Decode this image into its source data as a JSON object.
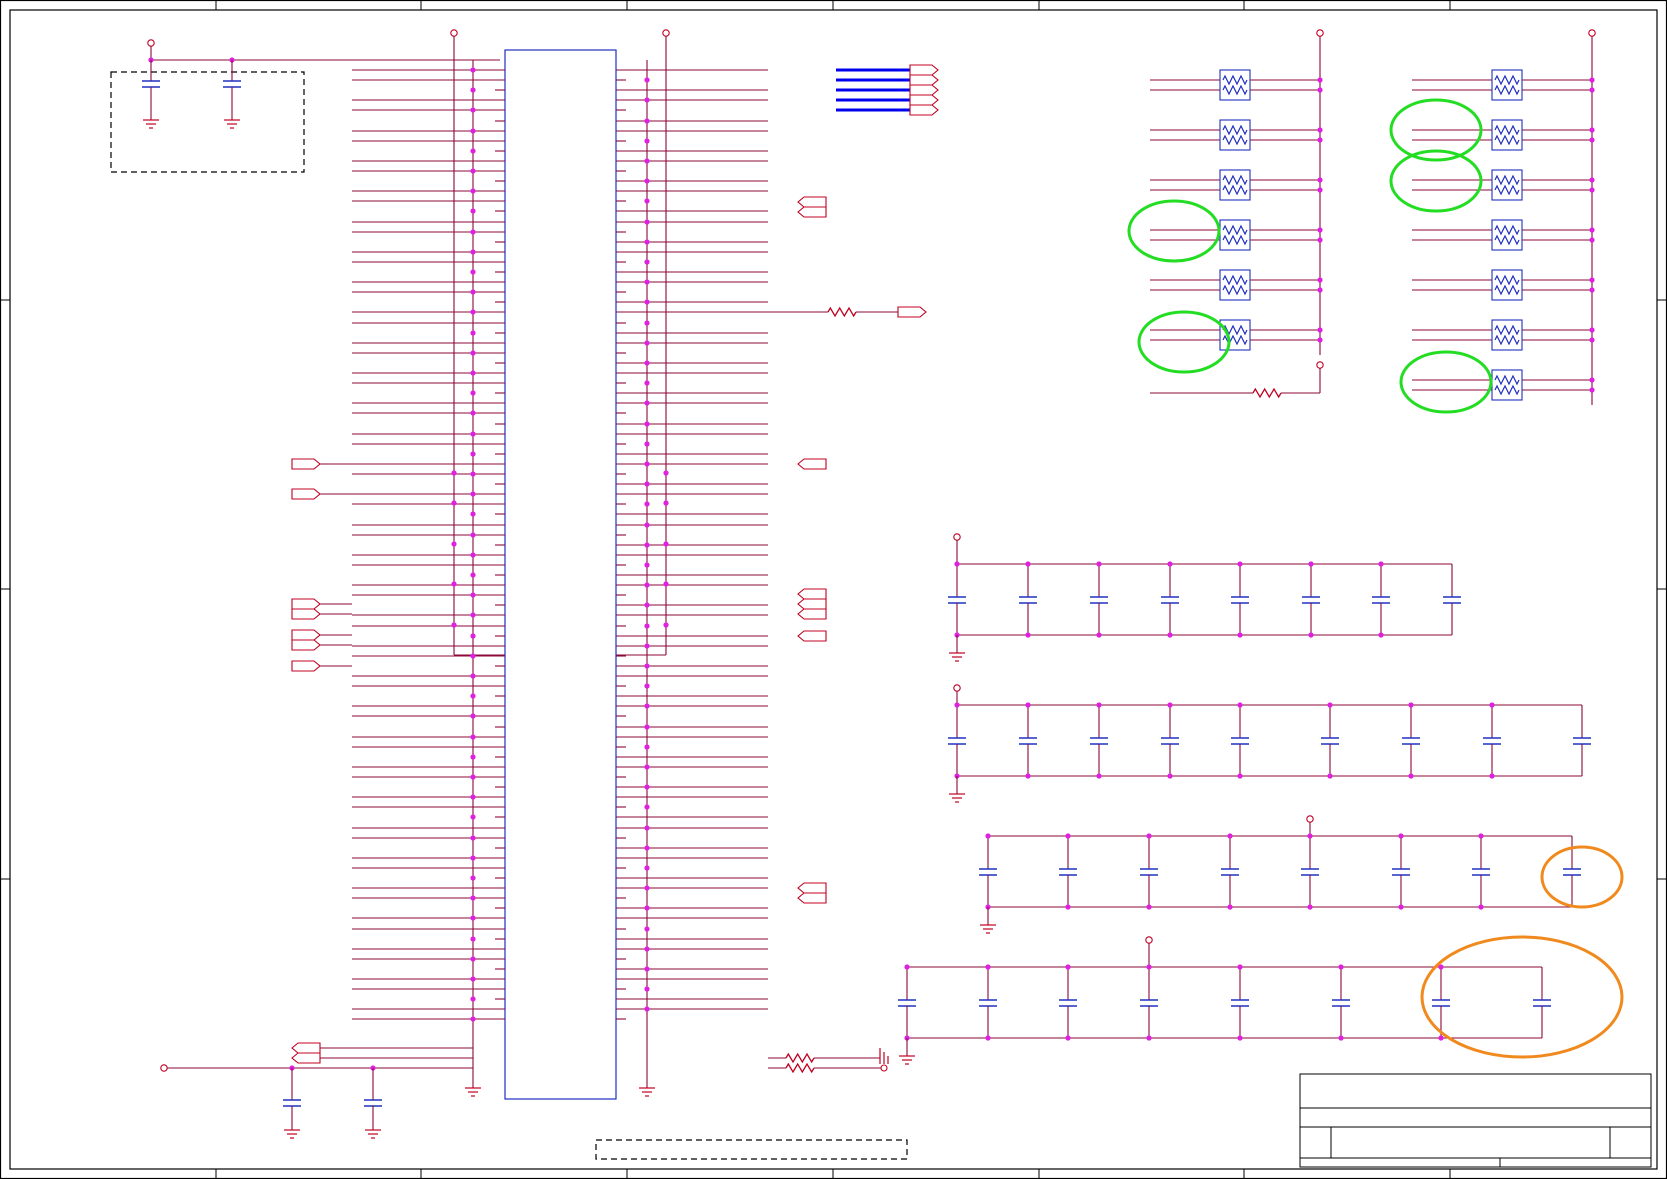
{
  "document": {
    "kind": "circuit schematic sheet"
  },
  "colors": {
    "net": "#8b0a3a",
    "component_outline": "#2030c0",
    "junction": "#e020e0",
    "power_symbol": "#c00020",
    "highlight_green": "#22dd22",
    "highlight_orange": "#f08a1e",
    "bus": "#0000ee"
  },
  "annotations": {
    "green_highlight_count": 5,
    "orange_highlight_count": 2
  },
  "title_block": {
    "text": ""
  }
}
